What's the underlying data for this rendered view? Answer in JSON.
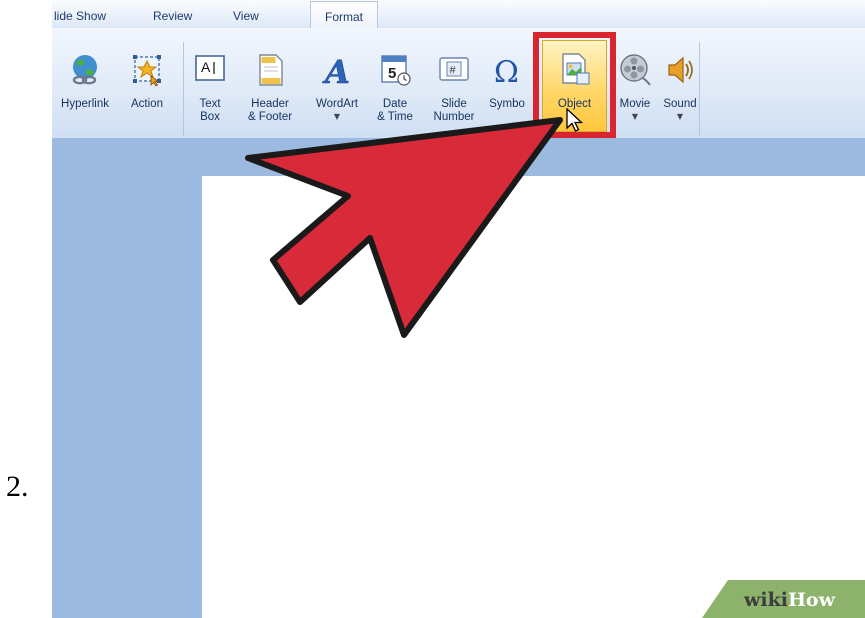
{
  "step": {
    "number": "2."
  },
  "tabs": [
    {
      "label": "lide Show"
    },
    {
      "label": "Review"
    },
    {
      "label": "View"
    },
    {
      "label": "Format"
    }
  ],
  "ribbon": {
    "buttons": [
      {
        "id": "hyperlink",
        "label": "Hyperlink",
        "icon": "globe-link-icon"
      },
      {
        "id": "action",
        "label": "Action",
        "icon": "action-star-icon"
      },
      {
        "id": "text-box",
        "label_line1": "Text",
        "label_line2": "Box",
        "icon": "text-box-icon"
      },
      {
        "id": "header-footer",
        "label_line1": "Header",
        "label_line2": "& Footer",
        "icon": "header-footer-icon"
      },
      {
        "id": "wordart",
        "label": "WordArt",
        "icon": "wordart-icon",
        "has_dropdown": true
      },
      {
        "id": "date-time",
        "label_line1": "Date",
        "label_line2": "& Time",
        "icon": "calendar-icon",
        "icon_text": "5"
      },
      {
        "id": "slide-number",
        "label_line1": "Slide",
        "label_line2": "Number",
        "icon": "slide-number-icon",
        "icon_text": "#"
      },
      {
        "id": "symbol",
        "label": "Symbo",
        "icon": "omega-icon",
        "icon_text": "Ω"
      },
      {
        "id": "object",
        "label": "Object",
        "icon": "object-icon",
        "state": "hovered"
      },
      {
        "id": "movie",
        "label": "Movie",
        "icon": "film-reel-icon",
        "has_dropdown": true
      },
      {
        "id": "sound",
        "label": "Sound",
        "icon": "speaker-icon",
        "has_dropdown": true
      }
    ],
    "dropdown_glyph": "▼"
  },
  "watermark": {
    "part1": "wiki",
    "part2": "How"
  },
  "colors": {
    "ribbon_text": "#15325e",
    "workspace": "#9cb9e0",
    "highlight": "#d8252f",
    "arrow_fill": "#d92a3a",
    "hover_fill": "#ffd76a",
    "watermark_green": "#8db26c"
  }
}
